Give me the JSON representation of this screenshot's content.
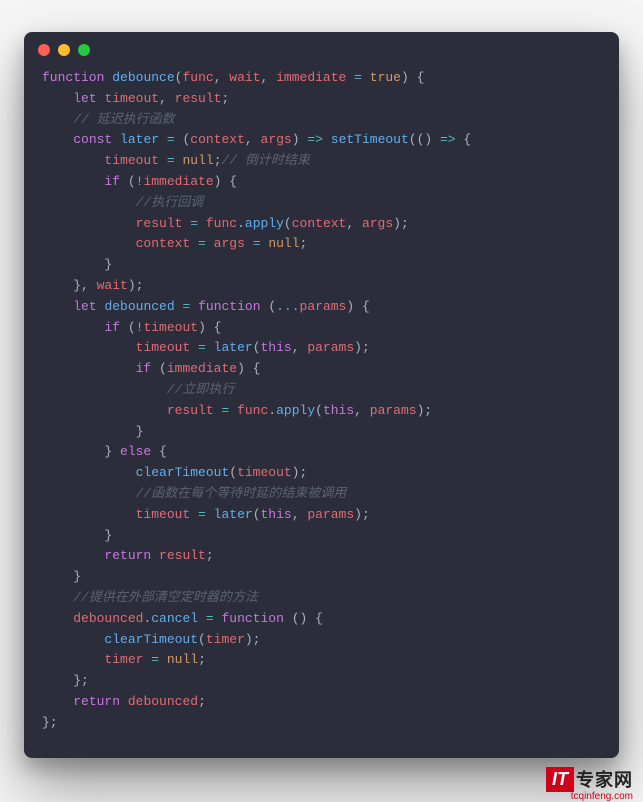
{
  "watermark": {
    "badge": "IT",
    "label": "专家网",
    "url": "tcqinfeng.com"
  },
  "code": {
    "lines": [
      [
        {
          "c": "kw",
          "t": "function"
        },
        {
          "c": "p",
          "t": " "
        },
        {
          "c": "fn",
          "t": "debounce"
        },
        {
          "c": "p",
          "t": "("
        },
        {
          "c": "id",
          "t": "func"
        },
        {
          "c": "p",
          "t": ", "
        },
        {
          "c": "id",
          "t": "wait"
        },
        {
          "c": "p",
          "t": ", "
        },
        {
          "c": "id",
          "t": "immediate"
        },
        {
          "c": "p",
          "t": " "
        },
        {
          "c": "op",
          "t": "="
        },
        {
          "c": "p",
          "t": " "
        },
        {
          "c": "bl",
          "t": "true"
        },
        {
          "c": "p",
          "t": ") {"
        }
      ],
      [
        {
          "c": "p",
          "t": "    "
        },
        {
          "c": "kw",
          "t": "let"
        },
        {
          "c": "p",
          "t": " "
        },
        {
          "c": "id",
          "t": "timeout"
        },
        {
          "c": "p",
          "t": ", "
        },
        {
          "c": "id",
          "t": "result"
        },
        {
          "c": "p",
          "t": ";"
        }
      ],
      [
        {
          "c": "p",
          "t": "    "
        },
        {
          "c": "cm",
          "t": "// 延迟执行函数"
        }
      ],
      [
        {
          "c": "p",
          "t": "    "
        },
        {
          "c": "kw",
          "t": "const"
        },
        {
          "c": "p",
          "t": " "
        },
        {
          "c": "fn",
          "t": "later"
        },
        {
          "c": "p",
          "t": " "
        },
        {
          "c": "op",
          "t": "="
        },
        {
          "c": "p",
          "t": " ("
        },
        {
          "c": "id",
          "t": "context"
        },
        {
          "c": "p",
          "t": ", "
        },
        {
          "c": "id",
          "t": "args"
        },
        {
          "c": "p",
          "t": ") "
        },
        {
          "c": "op",
          "t": "=>"
        },
        {
          "c": "p",
          "t": " "
        },
        {
          "c": "fn",
          "t": "setTimeout"
        },
        {
          "c": "p",
          "t": "(() "
        },
        {
          "c": "op",
          "t": "=>"
        },
        {
          "c": "p",
          "t": " {"
        }
      ],
      [
        {
          "c": "p",
          "t": "        "
        },
        {
          "c": "id",
          "t": "timeout"
        },
        {
          "c": "p",
          "t": " "
        },
        {
          "c": "op",
          "t": "="
        },
        {
          "c": "p",
          "t": " "
        },
        {
          "c": "bl",
          "t": "null"
        },
        {
          "c": "p",
          "t": ";"
        },
        {
          "c": "cm",
          "t": "// 倒计时结束"
        }
      ],
      [
        {
          "c": "p",
          "t": "        "
        },
        {
          "c": "kw",
          "t": "if"
        },
        {
          "c": "p",
          "t": " ("
        },
        {
          "c": "op",
          "t": "!"
        },
        {
          "c": "id",
          "t": "immediate"
        },
        {
          "c": "p",
          "t": ") {"
        }
      ],
      [
        {
          "c": "p",
          "t": "            "
        },
        {
          "c": "cm",
          "t": "//执行回调"
        }
      ],
      [
        {
          "c": "p",
          "t": "            "
        },
        {
          "c": "id",
          "t": "result"
        },
        {
          "c": "p",
          "t": " "
        },
        {
          "c": "op",
          "t": "="
        },
        {
          "c": "p",
          "t": " "
        },
        {
          "c": "id",
          "t": "func"
        },
        {
          "c": "p",
          "t": "."
        },
        {
          "c": "fn",
          "t": "apply"
        },
        {
          "c": "p",
          "t": "("
        },
        {
          "c": "id",
          "t": "context"
        },
        {
          "c": "p",
          "t": ", "
        },
        {
          "c": "id",
          "t": "args"
        },
        {
          "c": "p",
          "t": ");"
        }
      ],
      [
        {
          "c": "p",
          "t": "            "
        },
        {
          "c": "id",
          "t": "context"
        },
        {
          "c": "p",
          "t": " "
        },
        {
          "c": "op",
          "t": "="
        },
        {
          "c": "p",
          "t": " "
        },
        {
          "c": "id",
          "t": "args"
        },
        {
          "c": "p",
          "t": " "
        },
        {
          "c": "op",
          "t": "="
        },
        {
          "c": "p",
          "t": " "
        },
        {
          "c": "bl",
          "t": "null"
        },
        {
          "c": "p",
          "t": ";"
        }
      ],
      [
        {
          "c": "p",
          "t": "        }"
        }
      ],
      [
        {
          "c": "p",
          "t": "    }, "
        },
        {
          "c": "id",
          "t": "wait"
        },
        {
          "c": "p",
          "t": ");"
        }
      ],
      [
        {
          "c": "p",
          "t": "    "
        },
        {
          "c": "kw",
          "t": "let"
        },
        {
          "c": "p",
          "t": " "
        },
        {
          "c": "fn",
          "t": "debounced"
        },
        {
          "c": "p",
          "t": " "
        },
        {
          "c": "op",
          "t": "="
        },
        {
          "c": "p",
          "t": " "
        },
        {
          "c": "kw",
          "t": "function"
        },
        {
          "c": "p",
          "t": " ("
        },
        {
          "c": "s",
          "t": "..."
        },
        {
          "c": "id",
          "t": "params"
        },
        {
          "c": "p",
          "t": ") {"
        }
      ],
      [
        {
          "c": "p",
          "t": "        "
        },
        {
          "c": "kw",
          "t": "if"
        },
        {
          "c": "p",
          "t": " ("
        },
        {
          "c": "op",
          "t": "!"
        },
        {
          "c": "id",
          "t": "timeout"
        },
        {
          "c": "p",
          "t": ") {"
        }
      ],
      [
        {
          "c": "p",
          "t": "            "
        },
        {
          "c": "id",
          "t": "timeout"
        },
        {
          "c": "p",
          "t": " "
        },
        {
          "c": "op",
          "t": "="
        },
        {
          "c": "p",
          "t": " "
        },
        {
          "c": "fn",
          "t": "later"
        },
        {
          "c": "p",
          "t": "("
        },
        {
          "c": "kw",
          "t": "this"
        },
        {
          "c": "p",
          "t": ", "
        },
        {
          "c": "id",
          "t": "params"
        },
        {
          "c": "p",
          "t": ");"
        }
      ],
      [
        {
          "c": "p",
          "t": "            "
        },
        {
          "c": "kw",
          "t": "if"
        },
        {
          "c": "p",
          "t": " ("
        },
        {
          "c": "id",
          "t": "immediate"
        },
        {
          "c": "p",
          "t": ") {"
        }
      ],
      [
        {
          "c": "p",
          "t": "                "
        },
        {
          "c": "cm",
          "t": "//立即执行"
        }
      ],
      [
        {
          "c": "p",
          "t": "                "
        },
        {
          "c": "id",
          "t": "result"
        },
        {
          "c": "p",
          "t": " "
        },
        {
          "c": "op",
          "t": "="
        },
        {
          "c": "p",
          "t": " "
        },
        {
          "c": "id",
          "t": "func"
        },
        {
          "c": "p",
          "t": "."
        },
        {
          "c": "fn",
          "t": "apply"
        },
        {
          "c": "p",
          "t": "("
        },
        {
          "c": "kw",
          "t": "this"
        },
        {
          "c": "p",
          "t": ", "
        },
        {
          "c": "id",
          "t": "params"
        },
        {
          "c": "p",
          "t": ");"
        }
      ],
      [
        {
          "c": "p",
          "t": "            }"
        }
      ],
      [
        {
          "c": "p",
          "t": "        } "
        },
        {
          "c": "kw",
          "t": "else"
        },
        {
          "c": "p",
          "t": " {"
        }
      ],
      [
        {
          "c": "p",
          "t": "            "
        },
        {
          "c": "fn",
          "t": "clearTimeout"
        },
        {
          "c": "p",
          "t": "("
        },
        {
          "c": "id",
          "t": "timeout"
        },
        {
          "c": "p",
          "t": ");"
        }
      ],
      [
        {
          "c": "p",
          "t": "            "
        },
        {
          "c": "cm",
          "t": "//函数在每个等待时延的结束被调用"
        }
      ],
      [
        {
          "c": "p",
          "t": "            "
        },
        {
          "c": "id",
          "t": "timeout"
        },
        {
          "c": "p",
          "t": " "
        },
        {
          "c": "op",
          "t": "="
        },
        {
          "c": "p",
          "t": " "
        },
        {
          "c": "fn",
          "t": "later"
        },
        {
          "c": "p",
          "t": "("
        },
        {
          "c": "kw",
          "t": "this"
        },
        {
          "c": "p",
          "t": ", "
        },
        {
          "c": "id",
          "t": "params"
        },
        {
          "c": "p",
          "t": ");"
        }
      ],
      [
        {
          "c": "p",
          "t": "        }"
        }
      ],
      [
        {
          "c": "p",
          "t": "        "
        },
        {
          "c": "kw",
          "t": "return"
        },
        {
          "c": "p",
          "t": " "
        },
        {
          "c": "id",
          "t": "result"
        },
        {
          "c": "p",
          "t": ";"
        }
      ],
      [
        {
          "c": "p",
          "t": "    }"
        }
      ],
      [
        {
          "c": "p",
          "t": "    "
        },
        {
          "c": "cm",
          "t": "//提供在外部清空定时器的方法"
        }
      ],
      [
        {
          "c": "p",
          "t": "    "
        },
        {
          "c": "id",
          "t": "debounced"
        },
        {
          "c": "p",
          "t": "."
        },
        {
          "c": "fn",
          "t": "cancel"
        },
        {
          "c": "p",
          "t": " "
        },
        {
          "c": "op",
          "t": "="
        },
        {
          "c": "p",
          "t": " "
        },
        {
          "c": "kw",
          "t": "function"
        },
        {
          "c": "p",
          "t": " () {"
        }
      ],
      [
        {
          "c": "p",
          "t": "        "
        },
        {
          "c": "fn",
          "t": "clearTimeout"
        },
        {
          "c": "p",
          "t": "("
        },
        {
          "c": "id",
          "t": "timer"
        },
        {
          "c": "p",
          "t": ");"
        }
      ],
      [
        {
          "c": "p",
          "t": "        "
        },
        {
          "c": "id",
          "t": "timer"
        },
        {
          "c": "p",
          "t": " "
        },
        {
          "c": "op",
          "t": "="
        },
        {
          "c": "p",
          "t": " "
        },
        {
          "c": "bl",
          "t": "null"
        },
        {
          "c": "p",
          "t": ";"
        }
      ],
      [
        {
          "c": "p",
          "t": "    };"
        }
      ],
      [
        {
          "c": "p",
          "t": "    "
        },
        {
          "c": "kw",
          "t": "return"
        },
        {
          "c": "p",
          "t": " "
        },
        {
          "c": "id",
          "t": "debounced"
        },
        {
          "c": "p",
          "t": ";"
        }
      ],
      [
        {
          "c": "p",
          "t": "};"
        }
      ]
    ]
  }
}
